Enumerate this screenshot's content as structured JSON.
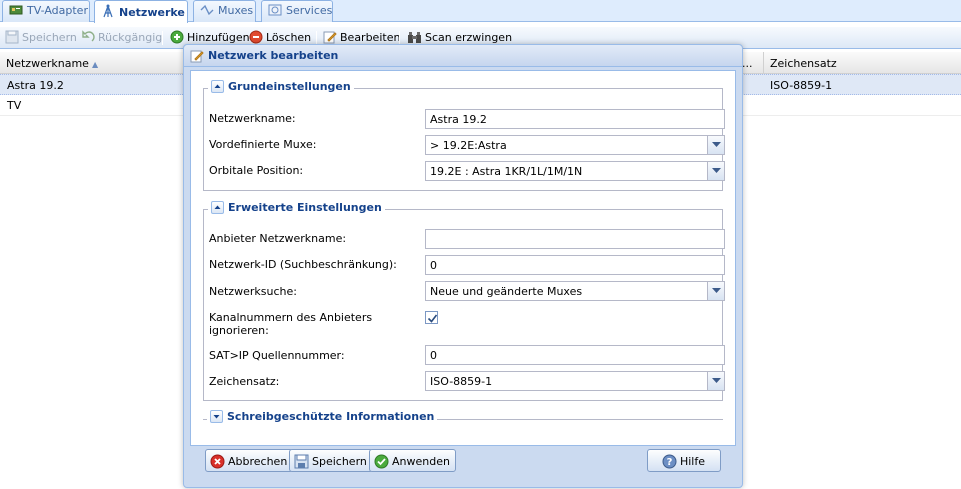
{
  "tabs": [
    {
      "label": "TV-Adapter",
      "icon": "tv-card-icon"
    },
    {
      "label": "Netzwerke",
      "icon": "antenna-icon"
    },
    {
      "label": "Muxes",
      "icon": "mux-icon"
    },
    {
      "label": "Services",
      "icon": "satellite-icon"
    }
  ],
  "toolbar": {
    "save": "Speichern",
    "undo": "Rückgängig",
    "add": "Hinzufügen",
    "delete": "Löschen",
    "edit": "Bearbeiten",
    "force_scan": "Scan erzwingen"
  },
  "grid": {
    "columns": [
      "Netzwerkname",
      "...",
      "Zeichensatz"
    ],
    "rows": [
      {
        "name": "Astra 19.2",
        "charset": "ISO-8859-1"
      },
      {
        "name": "TV",
        "charset": ""
      }
    ]
  },
  "dialog": {
    "title": "Netzwerk bearbeiten",
    "basic": {
      "legend": "Grundeinstellungen",
      "network_name_label": "Netzwerkname:",
      "network_name_value": "Astra 19.2",
      "predefined_muxes_label": "Vordefinierte Muxe:",
      "predefined_muxes_value": "> 19.2E:Astra",
      "orbital_label": "Orbitale Position:",
      "orbital_value": "19.2E : Astra 1KR/1L/1M/1N"
    },
    "advanced": {
      "legend": "Erweiterte Einstellungen",
      "provider_name_label": "Anbieter Netzwerkname:",
      "provider_name_value": "",
      "network_id_label": "Netzwerk-ID (Suchbeschränkung):",
      "network_id_value": "0",
      "network_search_label": "Netzwerksuche:",
      "network_search_value": "Neue und geänderte Muxes",
      "ignore_lcn_label_1": "Kanalnummern des Anbieters",
      "ignore_lcn_label_2": "ignorieren:",
      "ignore_lcn_checked": true,
      "satip_label": "SAT>IP Quellennummer:",
      "satip_value": "0",
      "charset_label": "Zeichensatz:",
      "charset_value": "ISO-8859-1"
    },
    "readonly": {
      "legend": "Schreibgeschützte Informationen"
    },
    "buttons": {
      "cancel": "Abbrechen",
      "save": "Speichern",
      "apply": "Anwenden",
      "help": "Hilfe"
    }
  },
  "colors": {
    "accent": "#15428b",
    "panel": "#cbdaf0",
    "border": "#99bbe8"
  }
}
